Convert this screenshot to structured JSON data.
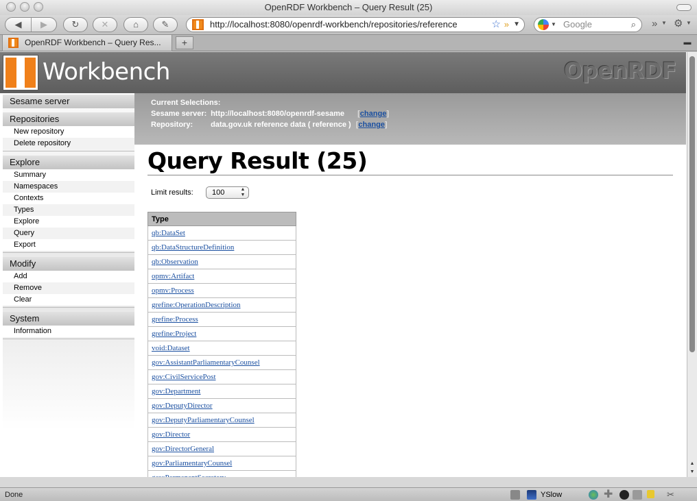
{
  "window": {
    "title": "OpenRDF Workbench – Query Result (25)"
  },
  "toolbar": {
    "url": "http://localhost:8080/openrdf-workbench/repositories/reference",
    "search_placeholder": "Google",
    "icons": [
      "back-icon",
      "forward-icon",
      "reload-icon",
      "stop-icon",
      "home-icon",
      "evernote-icon",
      "bookmark-star-icon",
      "rss-icon",
      "search-icon",
      "overflow-icon",
      "settings-icon"
    ]
  },
  "tabs": [
    {
      "label": "OpenRDF Workbench – Query Res..."
    }
  ],
  "newtab_label": "+",
  "header": {
    "logo_text": "Workbench",
    "brand": "OpenRDF"
  },
  "sidebar": {
    "sections": [
      {
        "heading": "Sesame server",
        "items": []
      },
      {
        "heading": "Repositories",
        "items": [
          "New repository",
          "Delete repository"
        ]
      },
      {
        "heading": "Explore",
        "items": [
          "Summary",
          "Namespaces",
          "Contexts",
          "Types",
          "Explore",
          "Query",
          "Export"
        ]
      },
      {
        "heading": "Modify",
        "items": [
          "Add",
          "Remove",
          "Clear"
        ]
      },
      {
        "heading": "System",
        "items": [
          "Information"
        ]
      }
    ]
  },
  "selections": {
    "title": "Current Selections:",
    "server_label": "Sesame server:",
    "server_value": "http://localhost:8080/openrdf-sesame",
    "repo_label": "Repository:",
    "repo_value": "data.gov.uk reference data ( reference )",
    "change_label": "change"
  },
  "main": {
    "title": "Query Result (25)",
    "limit_label": "Limit results:",
    "limit_value": "100"
  },
  "table": {
    "header": "Type",
    "rows": [
      "qb:DataSet",
      "qb:DataStructureDefinition",
      "qb:Observation",
      "opmv:Artifact",
      "opmv:Process",
      "grefine:OperationDescription",
      "grefine:Process",
      "grefine:Project",
      "void:Dataset",
      "gov:AssistantParliamentaryCounsel",
      "gov:CivilServicePost",
      "gov:Department",
      "gov:DeputyDirector",
      "gov:DeputyParliamentaryCounsel",
      "gov:Director",
      "gov:DirectorGeneral",
      "gov:ParliamentaryCounsel",
      "gov:PermanentSecretary"
    ]
  },
  "statusbar": {
    "status": "Done",
    "yslow": "YSlow"
  }
}
